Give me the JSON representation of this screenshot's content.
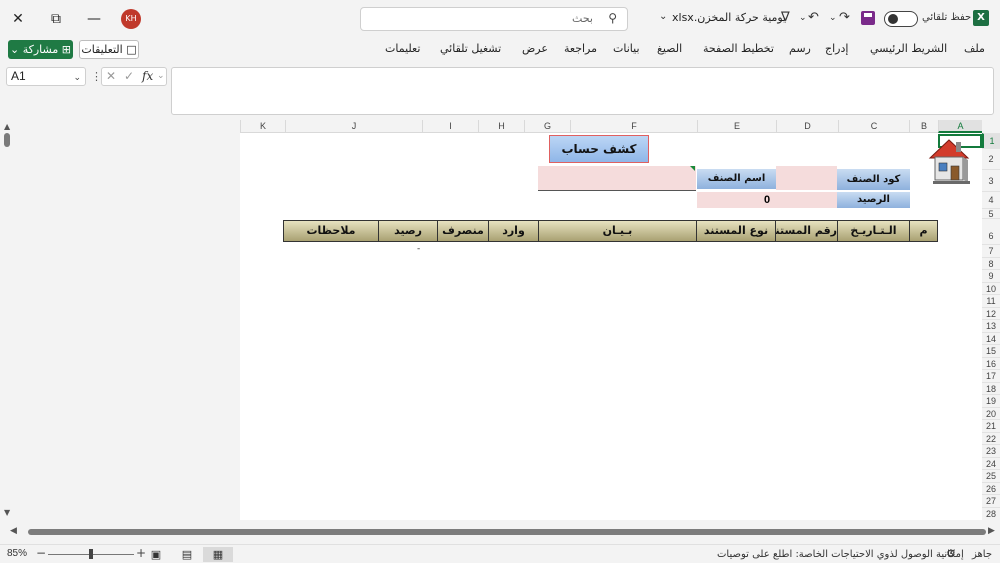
{
  "titlebar": {
    "window_close": "✕",
    "window_restore": "⧉",
    "window_minimize": "—",
    "avatar_initials": "KH",
    "search_placeholder": "بحث",
    "file_name": "يومية حركة المخزن.xlsx",
    "autosave_label": "حفظ تلقائي",
    "app_logo": "X",
    "icons": [
      "close-icon",
      "restore-icon",
      "minimize-icon",
      "search-icon",
      "customize-icon",
      "undo-icon",
      "redo-icon",
      "save-icon",
      "excel-logo-icon"
    ]
  },
  "ribbon": {
    "share_label": "مشاركة",
    "comments_label": "التعليقات",
    "tabs": [
      "ملف",
      "الشريط الرئيسي",
      "إدراج",
      "رسم",
      "تخطيط الصفحة",
      "الصيغ",
      "بيانات",
      "مراجعة",
      "عرض",
      "تشغيل تلقائي",
      "تعليمات"
    ]
  },
  "formula_bar": {
    "name_box": "A1",
    "fx_label": "fx",
    "formula_value": ""
  },
  "columns": [
    "A",
    "B",
    "C",
    "D",
    "E",
    "F",
    "G",
    "H",
    "I",
    "J",
    "K"
  ],
  "rows": [
    "1",
    "2",
    "3",
    "4",
    "5",
    "6",
    "7",
    "8",
    "9",
    "10",
    "11",
    "12",
    "13",
    "14",
    "15",
    "16",
    "17",
    "18",
    "19",
    "20",
    "21",
    "22",
    "23",
    "24",
    "25",
    "26",
    "27",
    "28"
  ],
  "sheet": {
    "title": "كشف حساب",
    "item_code_label": "كود الصنف",
    "item_name_label": "اسم الصنف",
    "balance_label": "الرصيد",
    "balance_value": "0",
    "table_headers": [
      "م",
      "الـتـاريـخ",
      "رقم المستند",
      "نوع المستند",
      "بـيـان",
      "وارد",
      "منصرف",
      "رصيد",
      "ملاحظات"
    ],
    "first_row_marker": "-"
  },
  "status_bar": {
    "ready": "جاهز",
    "accessibility": "إمكانية الوصول لذوي الاحتياجات الخاصة: اطلع على توصيات",
    "zoom": "85%"
  },
  "colors": {
    "excel_green": "#1f7a44",
    "header_olive": "#a9a172",
    "label_blue": "#8eb1dd",
    "input_pink": "#f5dcdc"
  }
}
